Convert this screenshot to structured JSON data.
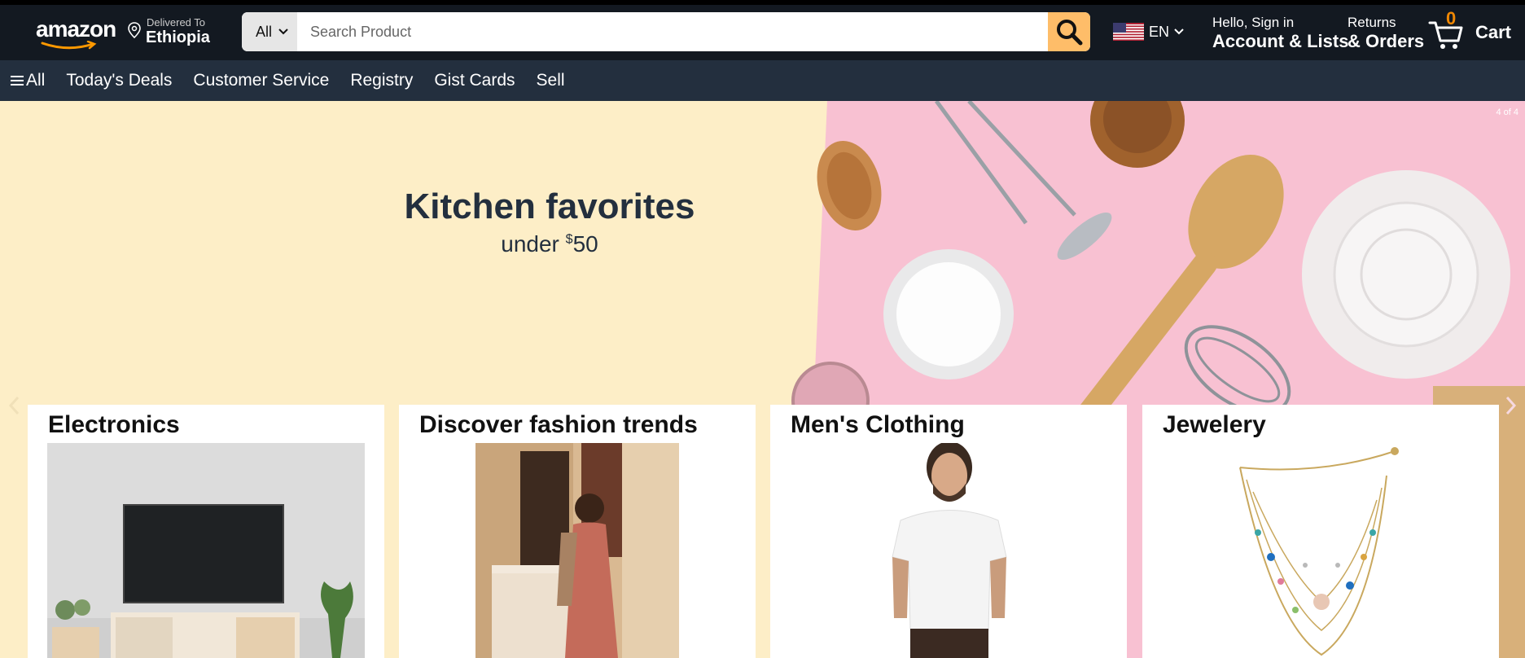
{
  "header": {
    "logo_text": "amazon",
    "deliver_to_label": "Delivered To",
    "deliver_to_location": "Ethiopia",
    "search_category": "All",
    "search_placeholder": "Search Product",
    "language": "EN",
    "account_greeting": "Hello, Sign in",
    "account_label": "Account & Lists",
    "returns_label": "Returns",
    "orders_label": "& Orders",
    "cart_count": "0",
    "cart_label": "Cart"
  },
  "nav": {
    "all_label": "All",
    "items": [
      "Today's Deals",
      "Customer Service",
      "Registry",
      "Gist Cards",
      "Sell"
    ]
  },
  "hero": {
    "title": "Kitchen favorites",
    "subtitle_prefix": "under ",
    "subtitle_currency": "$",
    "subtitle_amount": "50",
    "slide_counter": "4 of 4"
  },
  "cards": [
    {
      "title": "Electronics",
      "image": "tv-stand-image"
    },
    {
      "title": "Discover fashion trends",
      "image": "fashion-woman-image"
    },
    {
      "title": "Men's Clothing",
      "image": "man-tshirt-image"
    },
    {
      "title": "Jewelery",
      "image": "necklace-image"
    }
  ],
  "colors": {
    "topbar": "#131921",
    "navbar": "#232f3e",
    "search_button": "#febd69",
    "cart_count": "#f08804",
    "hero_left": "#fdeec7",
    "hero_right": "#f8c1d2"
  }
}
